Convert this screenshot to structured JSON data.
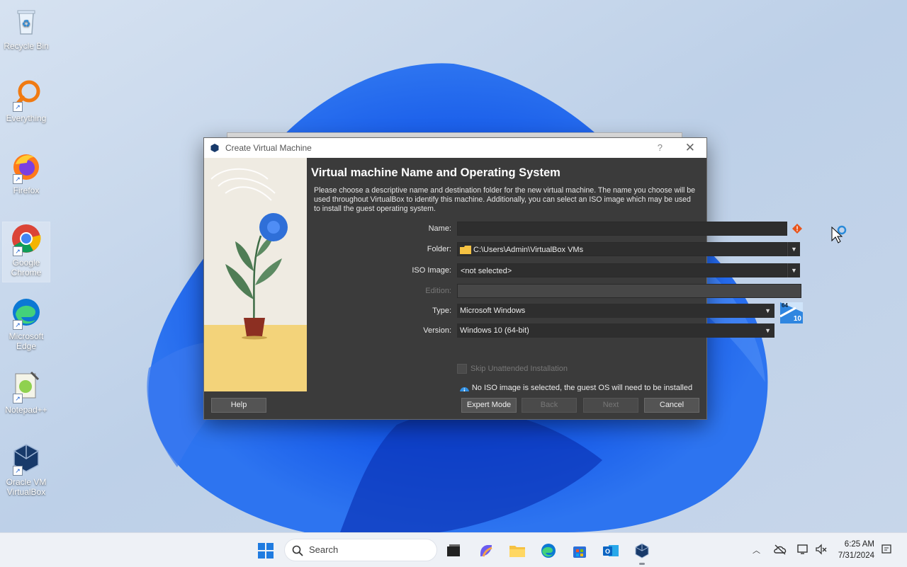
{
  "desktop": {
    "icons": [
      {
        "label": "Recycle Bin",
        "icon": "recycle-bin-icon"
      },
      {
        "label": "Everything",
        "icon": "everything-search-icon"
      },
      {
        "label": "Firefox",
        "icon": "firefox-icon"
      },
      {
        "label": "Google Chrome",
        "icon": "chrome-icon"
      },
      {
        "label": "Microsoft Edge",
        "icon": "edge-icon"
      },
      {
        "label": "Notepad++",
        "icon": "notepadpp-icon"
      },
      {
        "label": "Oracle VM VirtualBox",
        "icon": "virtualbox-icon"
      }
    ]
  },
  "dialog": {
    "title": "Create Virtual Machine",
    "help_glyph": "?",
    "close_glyph": "✕",
    "heading": "Virtual machine Name and Operating System",
    "description": "Please choose a descriptive name and destination folder for the new virtual machine. The name you choose will be used throughout VirtualBox to identify this machine. Additionally, you can select an ISO image which may be used to install the guest operating system.",
    "name_label": "Name:",
    "name_value": "",
    "folder_label": "Folder:",
    "folder_value": "C:\\Users\\Admin\\VirtualBox VMs",
    "iso_label": "ISO Image:",
    "iso_value": "<not selected>",
    "edition_label": "Edition:",
    "edition_value": "",
    "type_label": "Type:",
    "type_value": "Microsoft Windows",
    "version_label": "Version:",
    "version_value": "Windows 10 (64-bit)",
    "os_badge_top": "64",
    "os_badge_bottom": "10",
    "skip_unattended_label": "Skip Unattended Installation",
    "skip_unattended_checked": false,
    "info_message": "No ISO image is selected, the guest OS will need to be installed manually.",
    "buttons": {
      "help": "Help",
      "expert_mode": "Expert Mode",
      "back": "Back",
      "next": "Next",
      "cancel": "Cancel"
    }
  },
  "taskbar": {
    "search_placeholder": "Search",
    "pinned": [
      "start-icon",
      "task-view-icon",
      "copilot-icon",
      "file-explorer-icon",
      "edge-icon",
      "store-icon",
      "outlook-icon",
      "virtualbox-icon"
    ],
    "time": "6:25 AM",
    "date": "7/31/2024"
  },
  "colors": {
    "dialog_bg": "#3b3b3b",
    "field_bg": "#2e2e2e",
    "warning": "#e8541b",
    "info": "#2f8fe3"
  }
}
